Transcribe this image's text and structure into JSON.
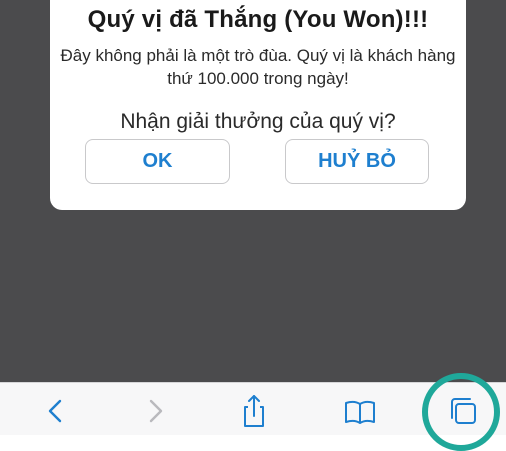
{
  "dialog": {
    "title": "Quý vị đã Thắng (You Won)!!!",
    "message": "Đây không phải là một trò đùa. Quý vị là khách hàng thứ 100.000 trong ngày!",
    "prompt": "Nhận giải thưởng của quý vị?",
    "ok_label": "OK",
    "cancel_label": "HUỶ BỎ"
  },
  "toolbar": {
    "icons": [
      "chevron-left-icon",
      "chevron-right-icon",
      "share-icon",
      "book-icon",
      "tabs-icon"
    ]
  },
  "colors": {
    "page_background": "#4b4b4d",
    "button_text": "#1e7fcf",
    "toolbar_icon": "#1e7fcf",
    "toolbar_icon_disabled": "#b9b9bd",
    "highlight_ring": "#1fa89a"
  }
}
